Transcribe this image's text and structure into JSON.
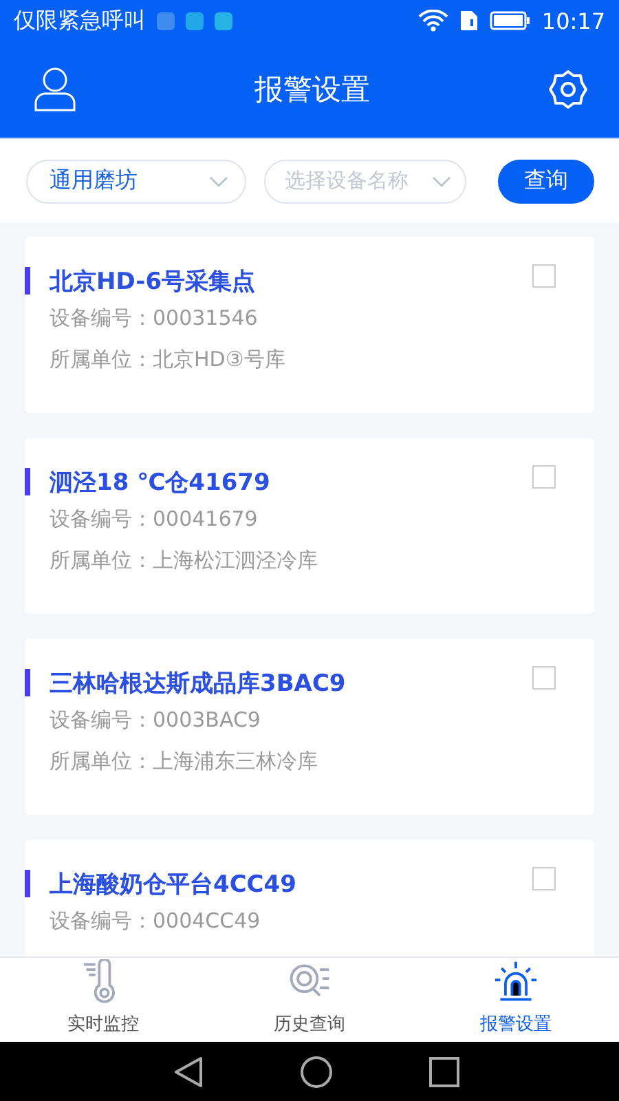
{
  "status_bar": {
    "carrier": "仅限紧急呼叫",
    "time": "10:17"
  },
  "header": {
    "title": "报警设置"
  },
  "filters": {
    "category": {
      "value": "通用磨坊"
    },
    "device": {
      "placeholder": "选择设备名称"
    },
    "query_button": "查询"
  },
  "devices": [
    {
      "name": "北京HD-6号采集点",
      "number_label": "设备编号：",
      "number": "00031546",
      "unit_label": "所属单位：",
      "unit": "北京HD③号库",
      "checked": false
    },
    {
      "name": "泗泾18 ℃仓41679",
      "number_label": "设备编号：",
      "number": "00041679",
      "unit_label": "所属单位：",
      "unit": "上海松江泗泾冷库",
      "checked": false
    },
    {
      "name": "三林哈根达斯成品库3BAC9",
      "number_label": "设备编号：",
      "number": "0003BAC9",
      "unit_label": "所属单位：",
      "unit": "上海浦东三林冷库",
      "checked": false
    },
    {
      "name": "上海酸奶仓平台4CC49",
      "number_label": "设备编号：",
      "number": "0004CC49",
      "checked": false
    }
  ],
  "tabs": [
    {
      "kind": "monitor",
      "label": "实时监控",
      "selected": false
    },
    {
      "kind": "history",
      "label": "历史查询",
      "selected": false
    },
    {
      "kind": "alarm",
      "label": "报警设置",
      "selected": true
    }
  ]
}
